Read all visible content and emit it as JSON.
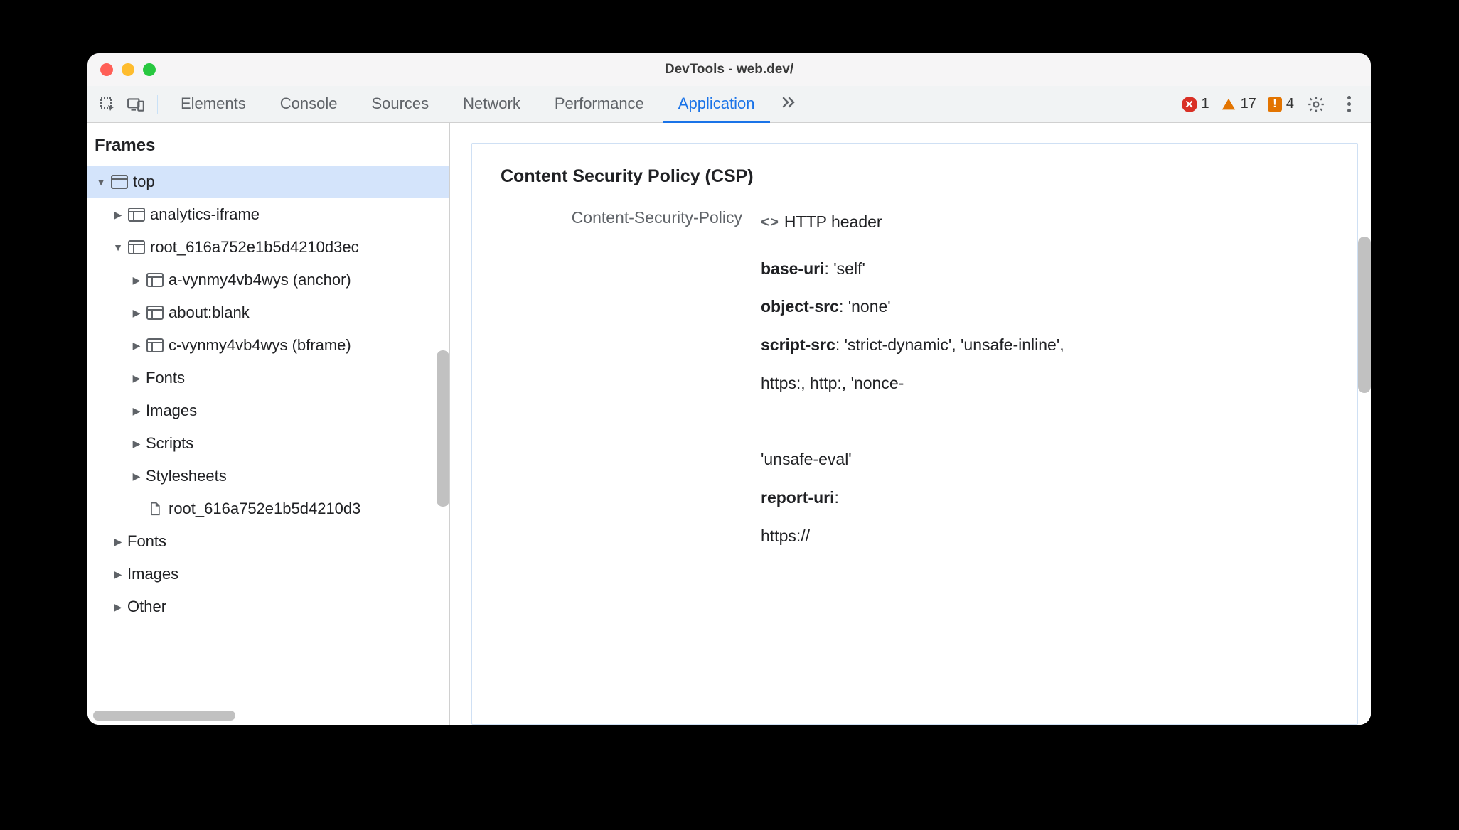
{
  "window": {
    "title": "DevTools - web.dev/"
  },
  "toolbar": {
    "tabs": [
      "Elements",
      "Console",
      "Sources",
      "Network",
      "Performance",
      "Application"
    ],
    "activeTab": "Application",
    "moreGlyph": "≫",
    "counts": {
      "errors": "1",
      "warnings": "17",
      "issues": "4"
    }
  },
  "sidebar": {
    "header": "Frames",
    "items": [
      {
        "label": "top",
        "depth": 0,
        "open": true,
        "icon": "window",
        "selected": true
      },
      {
        "label": "analytics-iframe",
        "depth": 1,
        "open": false,
        "icon": "frame",
        "tri": "closed"
      },
      {
        "label": "root_616a752e1b5d4210d3ec",
        "depth": 1,
        "open": true,
        "icon": "frame",
        "tri": "open"
      },
      {
        "label": "a-vynmy4vb4wys (anchor)",
        "depth": 2,
        "icon": "frame",
        "tri": "closed"
      },
      {
        "label": "about:blank",
        "depth": 2,
        "icon": "frame",
        "tri": "closed"
      },
      {
        "label": "c-vynmy4vb4wys (bframe)",
        "depth": 2,
        "icon": "frame",
        "tri": "closed"
      },
      {
        "label": "Fonts",
        "depth": 2,
        "tri": "closed"
      },
      {
        "label": "Images",
        "depth": 2,
        "tri": "closed"
      },
      {
        "label": "Scripts",
        "depth": 2,
        "tri": "closed"
      },
      {
        "label": "Stylesheets",
        "depth": 2,
        "tri": "closed"
      },
      {
        "label": "root_616a752e1b5d4210d3",
        "depth": 2,
        "icon": "doc",
        "tri": "none"
      },
      {
        "label": "Fonts",
        "depth": 1,
        "tri": "closed"
      },
      {
        "label": "Images",
        "depth": 1,
        "tri": "closed"
      },
      {
        "label": "Other",
        "depth": 1,
        "tri": "closed"
      }
    ]
  },
  "main": {
    "sectionTitle": "Content Security Policy (CSP)",
    "headerKey": "Content-Security-Policy",
    "headerSource": "HTTP header",
    "directives": [
      {
        "name": "base-uri",
        "value": "'self'"
      },
      {
        "name": "object-src",
        "value": "'none'"
      },
      {
        "name": "script-src",
        "value": "'strict-dynamic', 'unsafe-inline',"
      },
      {
        "plain": "https:, http:, 'nonce-"
      },
      {
        "plain": ""
      },
      {
        "plain": "'unsafe-eval'"
      },
      {
        "name": "report-uri",
        "value": ""
      },
      {
        "plain": "https://"
      }
    ]
  }
}
